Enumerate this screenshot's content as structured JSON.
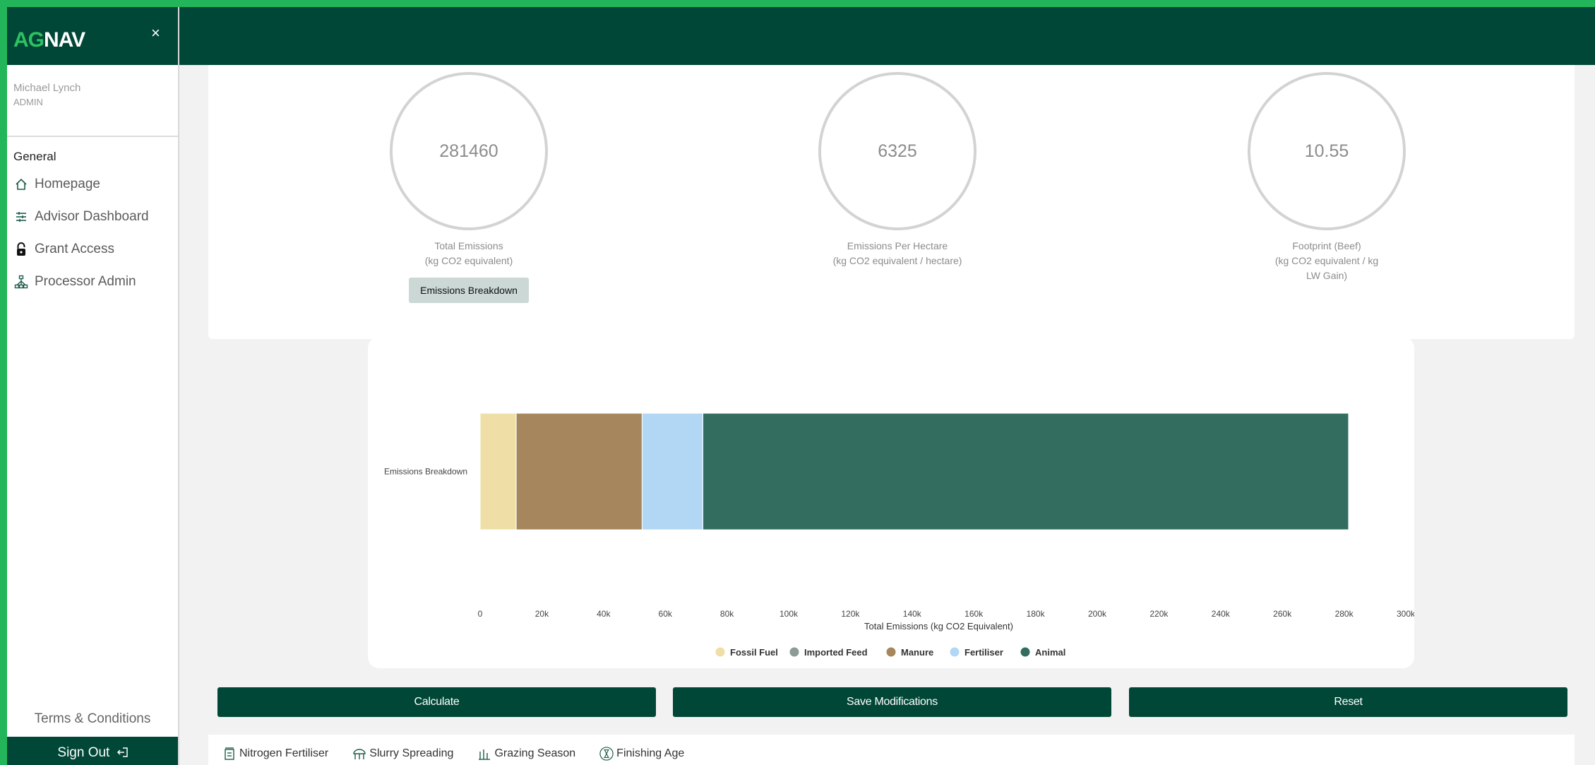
{
  "app": {
    "logo_ag": "AG",
    "logo_nav": "NAV"
  },
  "sidebar": {
    "close": "×",
    "user_name": "Michael Lynch",
    "user_role": "ADMIN",
    "section": "General",
    "items": [
      {
        "label": "Homepage",
        "icon": "home-icon"
      },
      {
        "label": "Advisor Dashboard",
        "icon": "sliders-icon"
      },
      {
        "label": "Grant Access",
        "icon": "lock-icon"
      },
      {
        "label": "Processor Admin",
        "icon": "network-icon"
      }
    ],
    "terms": "Terms & Conditions",
    "signout": "Sign Out"
  },
  "stats": [
    {
      "value": "281460",
      "label1": "Total Emissions",
      "label2": "(kg CO2 equivalent)",
      "label3": ""
    },
    {
      "value": "6325",
      "label1": "Emissions Per Hectare",
      "label2": "(kg CO2 equivalent / hectare)",
      "label3": ""
    },
    {
      "value": "10.55",
      "label1": "Footprint (Beef)",
      "label2": "(kg CO2 equivalent / kg",
      "label3": "LW Gain)"
    }
  ],
  "breakdown_button": "Emissions Breakdown",
  "chart_data": {
    "type": "bar",
    "orientation": "horizontal",
    "stacked": true,
    "categories": [
      "Emissions Breakdown"
    ],
    "series": [
      {
        "name": "Fossil Fuel",
        "values": [
          11700
        ],
        "color": "#efdfa6"
      },
      {
        "name": "Imported Feed",
        "values": [
          0
        ],
        "color": "#8c9b97"
      },
      {
        "name": "Manure",
        "values": [
          40800
        ],
        "color": "#a6865c"
      },
      {
        "name": "Fertiliser",
        "values": [
          19700
        ],
        "color": "#b1d7f4"
      },
      {
        "name": "Animal",
        "values": [
          209260
        ],
        "color": "#336d5f"
      }
    ],
    "xlabel": "Total Emissions (kg CO2 Equivalent)",
    "xlim": [
      0,
      300000
    ],
    "xticks": [
      "0",
      "20k",
      "40k",
      "60k",
      "80k",
      "100k",
      "120k",
      "140k",
      "160k",
      "180k",
      "200k",
      "220k",
      "240k",
      "260k",
      "280k",
      "300k"
    ],
    "legend_position": "bottom"
  },
  "actions": {
    "calculate": "Calculate",
    "save": "Save Modifications",
    "reset": "Reset"
  },
  "tabs": [
    {
      "label": "Nitrogen Fertiliser",
      "icon": "fertiliser-icon"
    },
    {
      "label": "Slurry Spreading",
      "icon": "spreader-icon"
    },
    {
      "label": "Grazing Season",
      "icon": "grass-icon"
    },
    {
      "label": "Finishing Age",
      "icon": "hourglass-icon"
    }
  ]
}
